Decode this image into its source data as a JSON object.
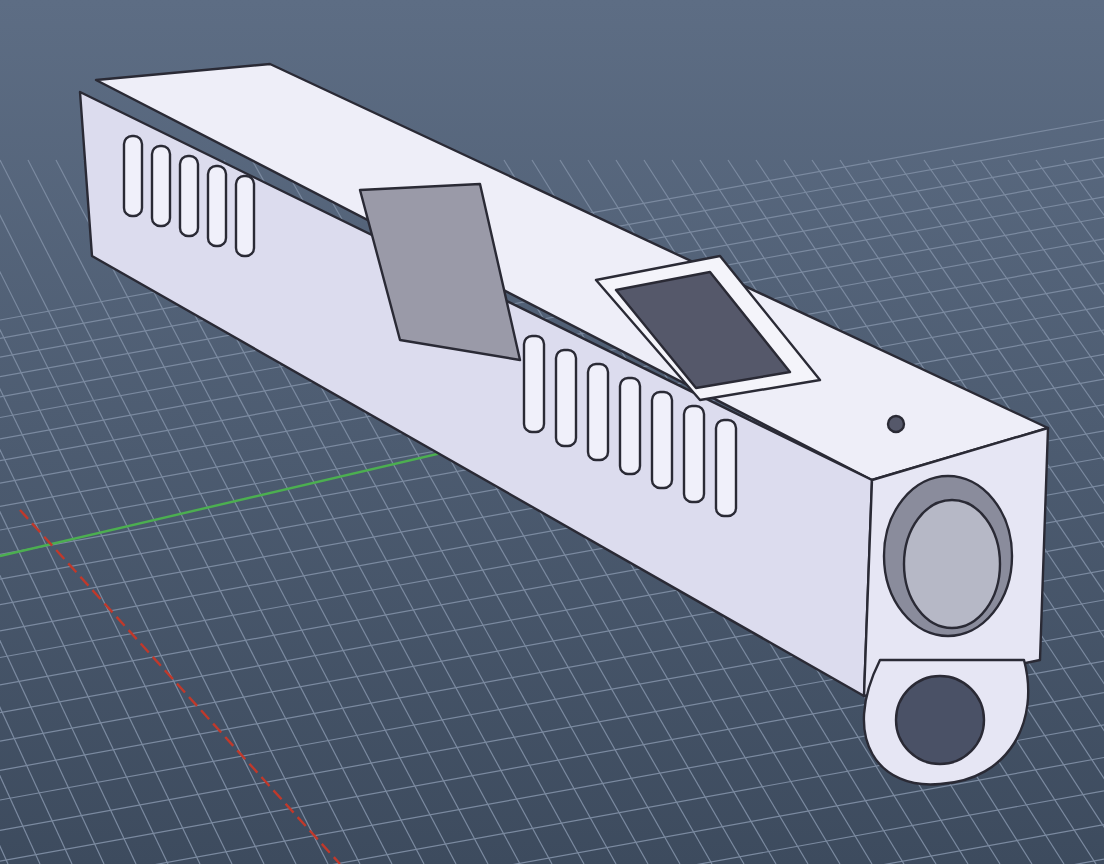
{
  "viewport": {
    "kind": "cad-model"
  }
}
